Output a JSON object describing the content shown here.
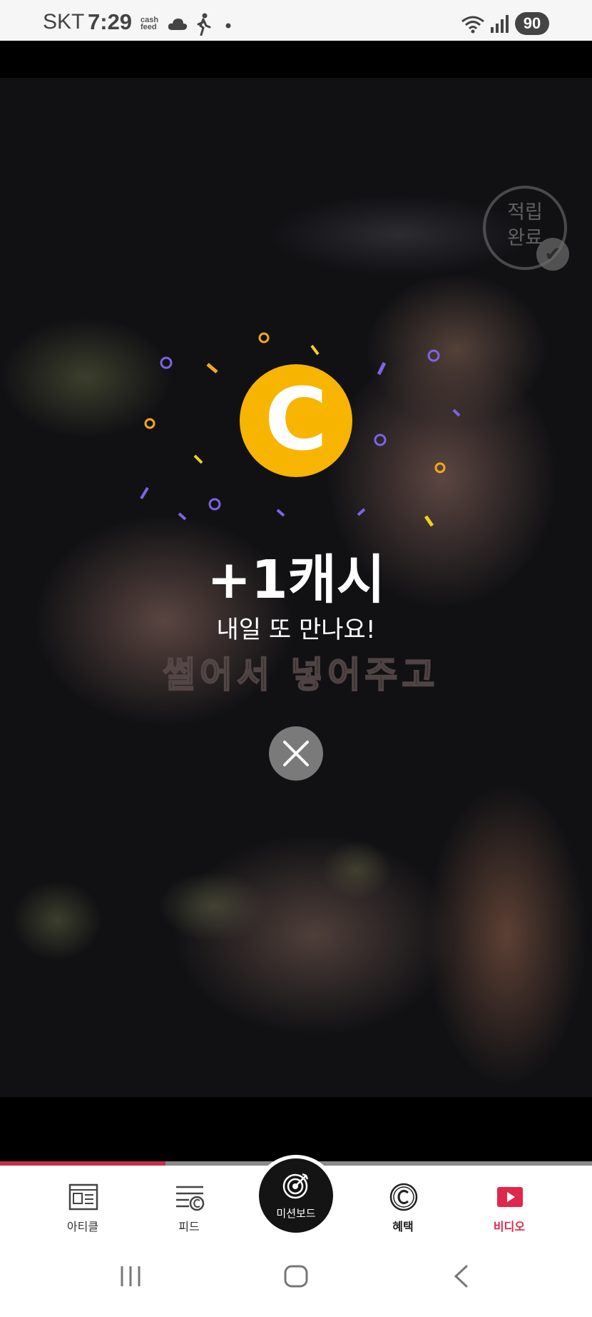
{
  "status_bar": {
    "carrier": "SKT",
    "time": "7:29",
    "cashfeed_line1": "cash",
    "cashfeed_line2": "feed",
    "battery": "90"
  },
  "video": {
    "subtitle": "썰어서 넣어주고",
    "stamp_line1": "적립",
    "stamp_line2": "완료"
  },
  "reward": {
    "coin_letter": "C",
    "amount": "+1캐시",
    "message": "내일 또 만나요!"
  },
  "progress": {
    "fraction": 0.28
  },
  "bottom_nav": {
    "items": [
      {
        "label": "아티클",
        "icon": "article-icon"
      },
      {
        "label": "피드",
        "icon": "feed-icon"
      },
      {
        "label": "미션보드",
        "icon": "mission-target-icon"
      },
      {
        "label": "혜택",
        "icon": "benefit-coin-icon"
      },
      {
        "label": "비디오",
        "icon": "video-play-icon"
      }
    ],
    "active_color": "#e0284a"
  },
  "colors": {
    "coin": "#f7b500",
    "progress": "#c0314a"
  }
}
